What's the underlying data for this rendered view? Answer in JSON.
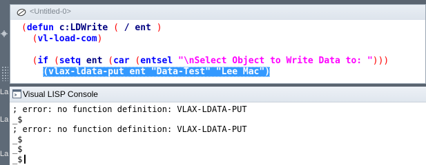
{
  "background": {
    "labels": [
      "La",
      "La",
      "La"
    ]
  },
  "editor": {
    "title": "<Untitled-0>",
    "lines": [
      {
        "tokens": [
          {
            "t": "(",
            "c": "paren"
          },
          {
            "t": "defun",
            "c": "kw"
          },
          {
            "t": " c:LDWrite ",
            "c": "fn"
          },
          {
            "t": "(",
            "c": "paren"
          },
          {
            "t": " / ent ",
            "c": "fn"
          },
          {
            "t": ")",
            "c": "paren"
          }
        ]
      },
      {
        "tokens": [
          {
            "t": "  ",
            "c": ""
          },
          {
            "t": "(",
            "c": "paren"
          },
          {
            "t": "vl-load-com",
            "c": "kw"
          },
          {
            "t": ")",
            "c": "paren"
          }
        ]
      },
      {
        "tokens": []
      },
      {
        "tokens": [
          {
            "t": "  ",
            "c": ""
          },
          {
            "t": "(",
            "c": "paren"
          },
          {
            "t": "if",
            "c": "kw"
          },
          {
            "t": " ",
            "c": ""
          },
          {
            "t": "(",
            "c": "paren"
          },
          {
            "t": "setq",
            "c": "kw"
          },
          {
            "t": " ent ",
            "c": "fn"
          },
          {
            "t": "(",
            "c": "paren"
          },
          {
            "t": "car",
            "c": "kw"
          },
          {
            "t": " ",
            "c": ""
          },
          {
            "t": "(",
            "c": "paren"
          },
          {
            "t": "entsel",
            "c": "kw"
          },
          {
            "t": " ",
            "c": ""
          },
          {
            "t": "\"\\nSelect Object to Write Data to: \"",
            "c": "str"
          },
          {
            "t": ")))",
            "c": "paren"
          }
        ]
      },
      {
        "tokens": [
          {
            "t": "    ",
            "c": ""
          },
          {
            "t": "(vlax-ldata-put ent \"Data-Test\" \"Lee Mac\")",
            "c": "sel"
          }
        ]
      }
    ]
  },
  "console": {
    "title": "Visual LISP Console",
    "lines": [
      "; error: no function definition: VLAX-LDATA-PUT",
      "_$",
      "; error: no function definition: VLAX-LDATA-PUT",
      "_$",
      "_$",
      "_$"
    ]
  },
  "colors": {
    "paren": "#ff0000",
    "keyword": "#0000ff",
    "symbol": "#000080",
    "string": "#ff00ff",
    "selection": "#3399ff"
  }
}
